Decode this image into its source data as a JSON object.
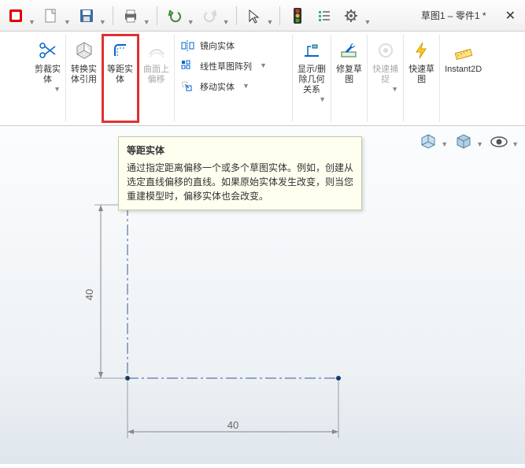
{
  "window_title": "草图1 – 零件1 *",
  "topbar": {
    "new": "new",
    "save": "save",
    "print": "print",
    "undo": "undo",
    "redo": "redo",
    "select": "select",
    "rebuild": "rebuild",
    "options_list": "options",
    "settings": "settings"
  },
  "ribbon": {
    "trim": "剪裁实\n体",
    "convert": "转换实\n体引用",
    "offset": "等距实\n体",
    "surface_offset": "曲面上\n偏移",
    "mirror": "镜向实体",
    "linear_pattern": "线性草图阵列",
    "move": "移动实体",
    "display_relations": "显示/删\n除几何\n关系",
    "repair": "修复草\n图",
    "quick_snap": "快速捕\n捉",
    "rapid_sketch": "快速草\n图",
    "instant2d": "Instant2D"
  },
  "tooltip": {
    "title": "等距实体",
    "body": "通过指定距离偏移一个或多个草图实体。例如，创建从选定直线偏移的直线。如果原始实体发生改变，则当您重建模型时，偏移实体也会改变。"
  },
  "sketch": {
    "dim_v": "40",
    "dim_h": "40"
  }
}
